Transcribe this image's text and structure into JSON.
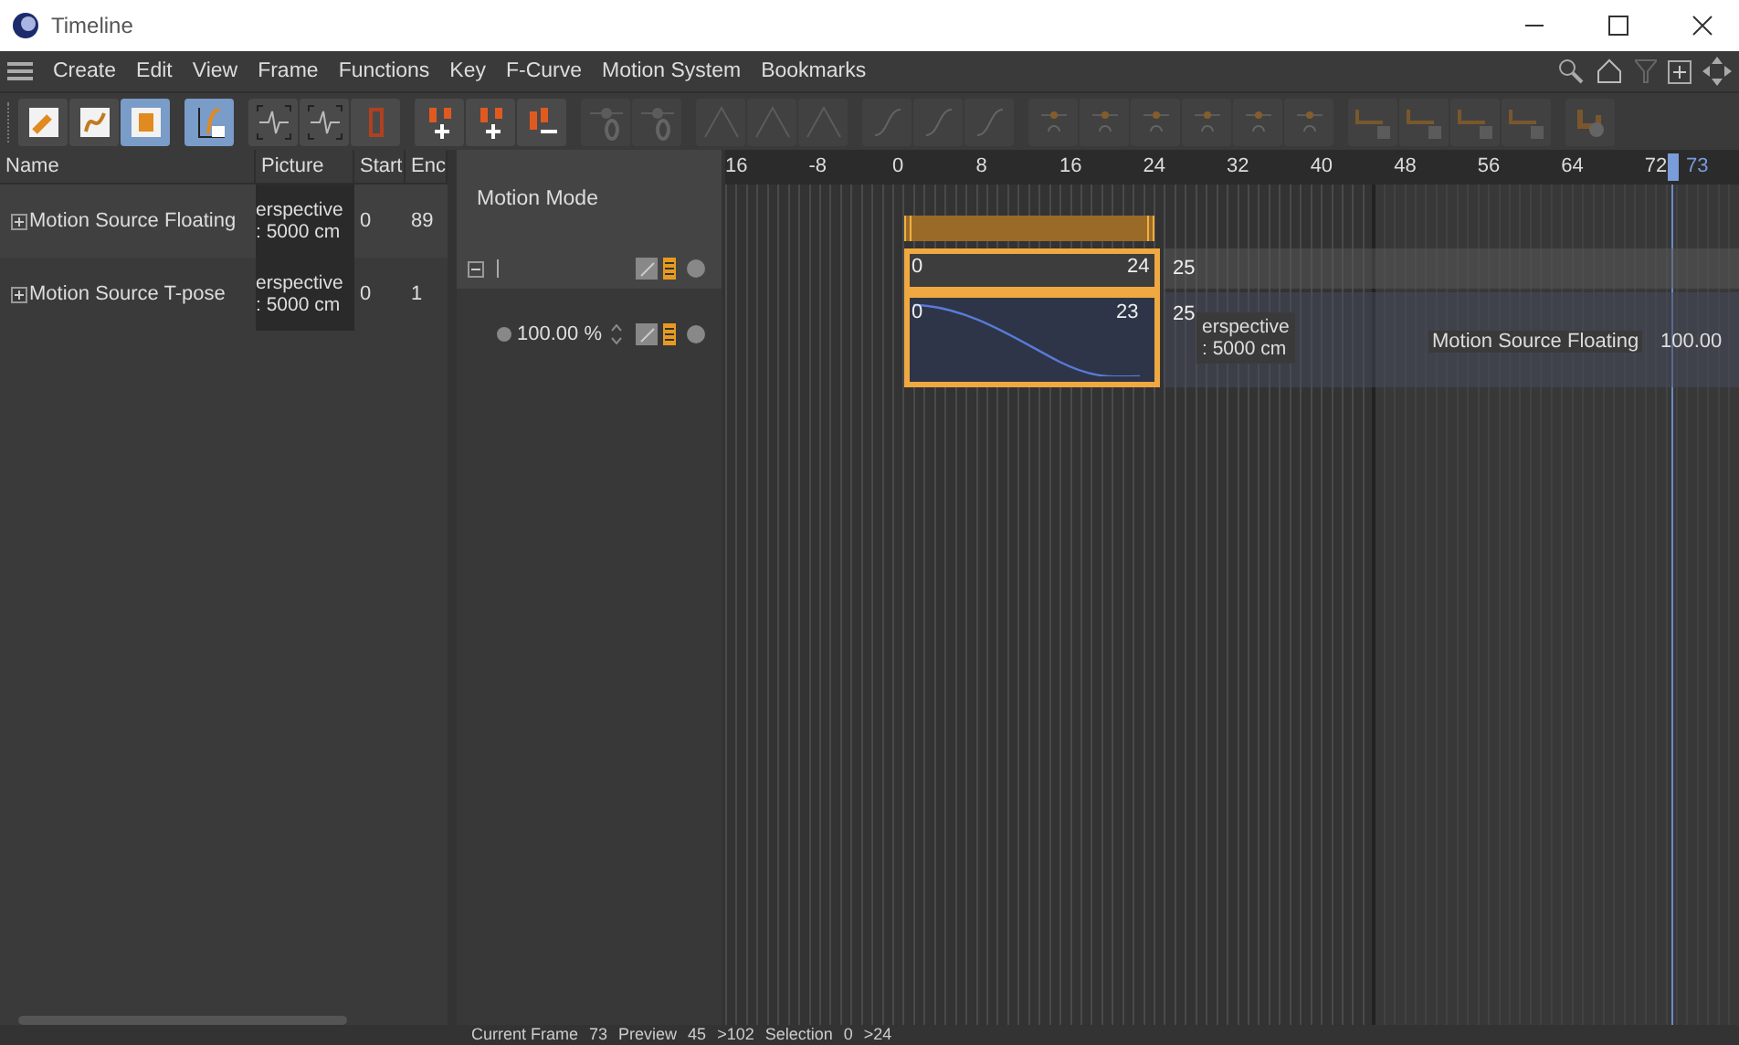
{
  "window": {
    "title": "Timeline"
  },
  "menu": [
    "Create",
    "Edit",
    "View",
    "Frame",
    "Functions",
    "Key",
    "F-Curve",
    "Motion System",
    "Bookmarks"
  ],
  "toolbar": [
    {
      "kind": "wrench",
      "selected": false,
      "disabled": false
    },
    {
      "kind": "fcurve",
      "selected": false,
      "disabled": false
    },
    {
      "kind": "range",
      "selected": true,
      "disabled": false
    },
    {
      "kind": "fview",
      "selected": true,
      "disabled": false
    },
    {
      "kind": "wave",
      "selected": false,
      "disabled": false
    },
    {
      "kind": "wave",
      "selected": false,
      "disabled": false
    },
    {
      "kind": "bracket",
      "selected": false,
      "disabled": false
    },
    {
      "kind": "keyadd",
      "selected": false,
      "disabled": false
    },
    {
      "kind": "keyadd",
      "selected": false,
      "disabled": false
    },
    {
      "kind": "keyremove",
      "selected": false,
      "disabled": false
    },
    {
      "kind": "keyzero",
      "selected": false,
      "disabled": true
    },
    {
      "kind": "keyzero",
      "selected": false,
      "disabled": true
    },
    {
      "kind": "tangent",
      "selected": false,
      "disabled": true
    },
    {
      "kind": "tangent",
      "selected": false,
      "disabled": true
    },
    {
      "kind": "tangent",
      "selected": false,
      "disabled": true
    },
    {
      "kind": "curve",
      "selected": false,
      "disabled": true
    },
    {
      "kind": "curve",
      "selected": false,
      "disabled": true
    },
    {
      "kind": "curve",
      "selected": false,
      "disabled": true
    },
    {
      "kind": "clamp",
      "selected": false,
      "disabled": true
    },
    {
      "kind": "clamp",
      "selected": false,
      "disabled": true
    },
    {
      "kind": "clamp",
      "selected": false,
      "disabled": true
    },
    {
      "kind": "clamp",
      "selected": false,
      "disabled": true
    },
    {
      "kind": "clamp",
      "selected": false,
      "disabled": true
    },
    {
      "kind": "clamp",
      "selected": false,
      "disabled": true
    },
    {
      "kind": "lock",
      "selected": false,
      "disabled": true
    },
    {
      "kind": "lock",
      "selected": false,
      "disabled": true
    },
    {
      "kind": "lock",
      "selected": false,
      "disabled": true
    },
    {
      "kind": "lock",
      "selected": false,
      "disabled": true
    },
    {
      "kind": "motion",
      "selected": false,
      "disabled": true
    }
  ],
  "tree": {
    "columns": [
      "Name",
      "Picture",
      "Start",
      "Enc"
    ],
    "rows": [
      {
        "name": "Motion Source Floating",
        "picture": [
          "erspective",
          ": 5000 cm"
        ],
        "start": "0",
        "end": "89"
      },
      {
        "name": "Motion Source T-pose",
        "picture": [
          "erspective",
          ": 5000 cm"
        ],
        "start": "0",
        "end": "1"
      }
    ]
  },
  "motion_mode": {
    "title": "Motion Mode",
    "rows": [
      {
        "kind": "group",
        "expanded": true
      },
      {
        "kind": "value",
        "value": "100.00 %"
      }
    ]
  },
  "timeline": {
    "ruler": [
      "16",
      "-8",
      "0",
      "8",
      "16",
      "24",
      "32",
      "40",
      "48",
      "56",
      "64",
      "72"
    ],
    "current_frame": "73",
    "tracks": [
      {
        "kind": "range"
      },
      {
        "kind": "clip",
        "start": "0",
        "end": "24",
        "after": "25"
      },
      {
        "kind": "curve",
        "start": "0",
        "end": "23",
        "after": "25",
        "tooltip": [
          "erspective",
          ": 5000 cm"
        ],
        "caption": "Motion Source Floating",
        "caption_value": "100.00"
      }
    ]
  },
  "status": [
    "Current Frame",
    "73",
    "Preview",
    "45",
    ">102",
    "Selection",
    "0",
    ">24"
  ]
}
